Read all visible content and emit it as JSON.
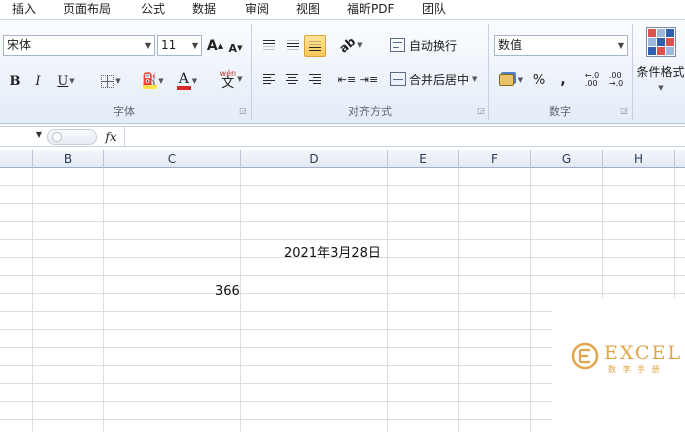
{
  "tabs": [
    "插入",
    "页面布局",
    "公式",
    "数据",
    "审阅",
    "视图",
    "福昕PDF",
    "团队"
  ],
  "font": {
    "name": "宋体",
    "size": "11",
    "grow_label": "A",
    "shrink_label": "A",
    "bold": "B",
    "italic": "I",
    "underline": "U",
    "font_color_label": "A",
    "phonetic_label": "wén",
    "phonetic_char": "文",
    "group_label": "字体"
  },
  "alignment": {
    "wrap_label": "自动换行",
    "merge_label": "合并后居中",
    "group_label": "对齐方式"
  },
  "number": {
    "format": "数值",
    "percent": "%",
    "comma": ",",
    "group_label": "数字"
  },
  "styles": {
    "conditional_label": "条件格式"
  },
  "formula": {
    "fx": "fx",
    "value": ""
  },
  "columns": [
    "B",
    "C",
    "D",
    "E",
    "F",
    "G",
    "H"
  ],
  "cells": {
    "d_date": "2021年3月28日",
    "c_value": "366"
  },
  "watermark": {
    "brand": "EXCEL",
    "sub": "数 李 手 册",
    "mark_color": "#e2a54a"
  }
}
